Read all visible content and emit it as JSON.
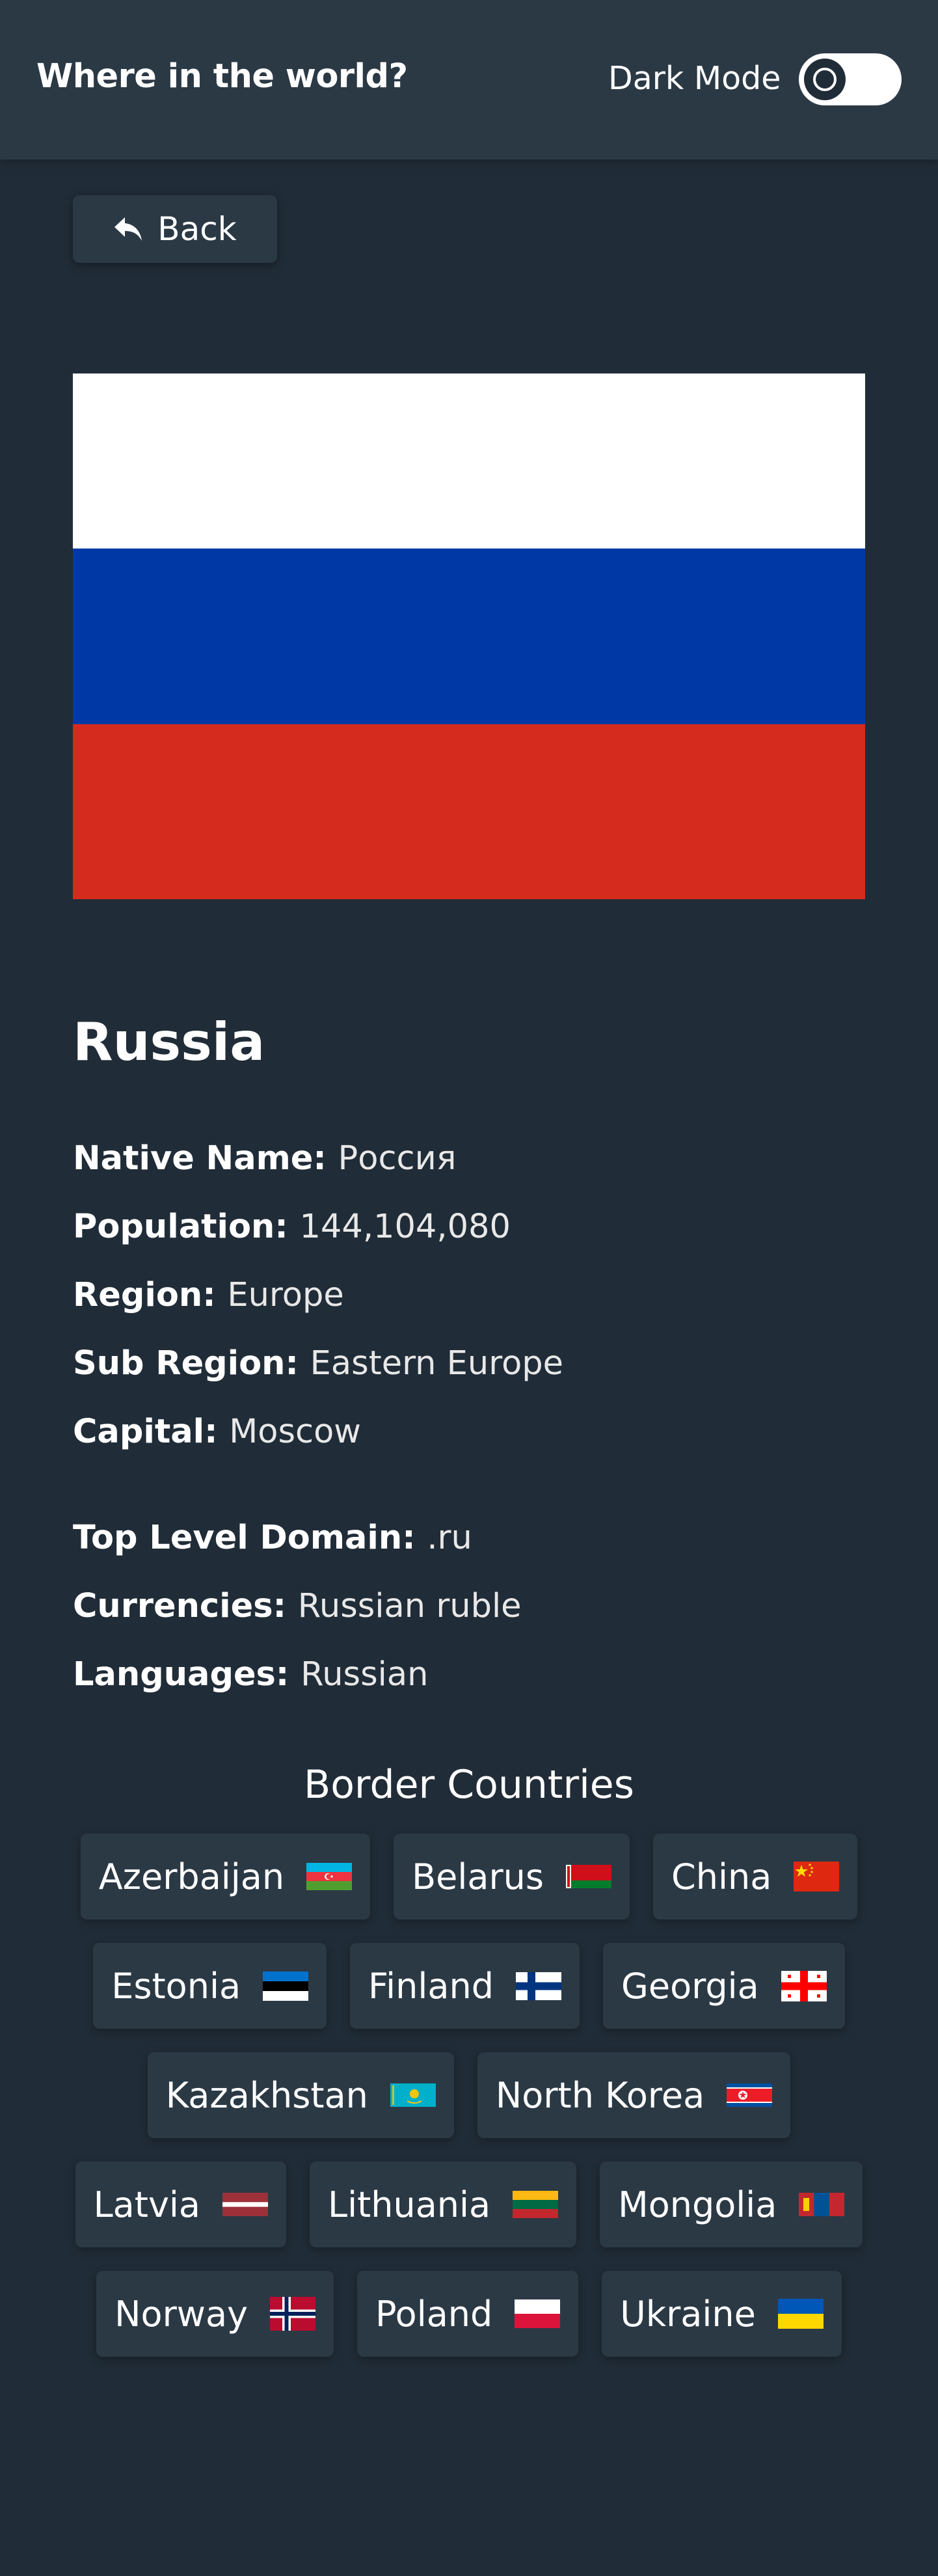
{
  "header": {
    "title": "Where in the world?",
    "dark_mode_label": "Dark Mode",
    "toggle_icon": "moon-icon"
  },
  "back_button": {
    "label": "Back",
    "icon": "reply-arrow-icon"
  },
  "country": {
    "name": "Russia",
    "flag_colors": [
      "#ffffff",
      "#0039a6",
      "#d52b1e"
    ],
    "details": [
      {
        "label": "Native Name:",
        "value": "Россия"
      },
      {
        "label": "Population:",
        "value": "144,104,080"
      },
      {
        "label": "Region:",
        "value": "Europe"
      },
      {
        "label": "Sub Region:",
        "value": "Eastern Europe"
      },
      {
        "label": "Capital:",
        "value": "Moscow"
      }
    ],
    "extra": [
      {
        "label": "Top Level Domain:",
        "value": ".ru"
      },
      {
        "label": "Currencies:",
        "value": "Russian ruble"
      },
      {
        "label": "Languages:",
        "value": "Russian"
      }
    ]
  },
  "border_section": {
    "title": "Border Countries",
    "countries": [
      {
        "name": "Azerbaijan",
        "flag": "azerbaijan-flag"
      },
      {
        "name": "Belarus",
        "flag": "belarus-flag"
      },
      {
        "name": "China",
        "flag": "china-flag"
      },
      {
        "name": "Estonia",
        "flag": "estonia-flag"
      },
      {
        "name": "Finland",
        "flag": "finland-flag"
      },
      {
        "name": "Georgia",
        "flag": "georgia-flag"
      },
      {
        "name": "Kazakhstan",
        "flag": "kazakhstan-flag"
      },
      {
        "name": "North Korea",
        "flag": "north-korea-flag"
      },
      {
        "name": "Latvia",
        "flag": "latvia-flag"
      },
      {
        "name": "Lithuania",
        "flag": "lithuania-flag"
      },
      {
        "name": "Mongolia",
        "flag": "mongolia-flag"
      },
      {
        "name": "Norway",
        "flag": "norway-flag"
      },
      {
        "name": "Poland",
        "flag": "poland-flag"
      },
      {
        "name": "Ukraine",
        "flag": "ukraine-flag"
      }
    ]
  },
  "colors": {
    "background": "#202c37",
    "elements": "#2b3945",
    "text": "#ffffff"
  }
}
